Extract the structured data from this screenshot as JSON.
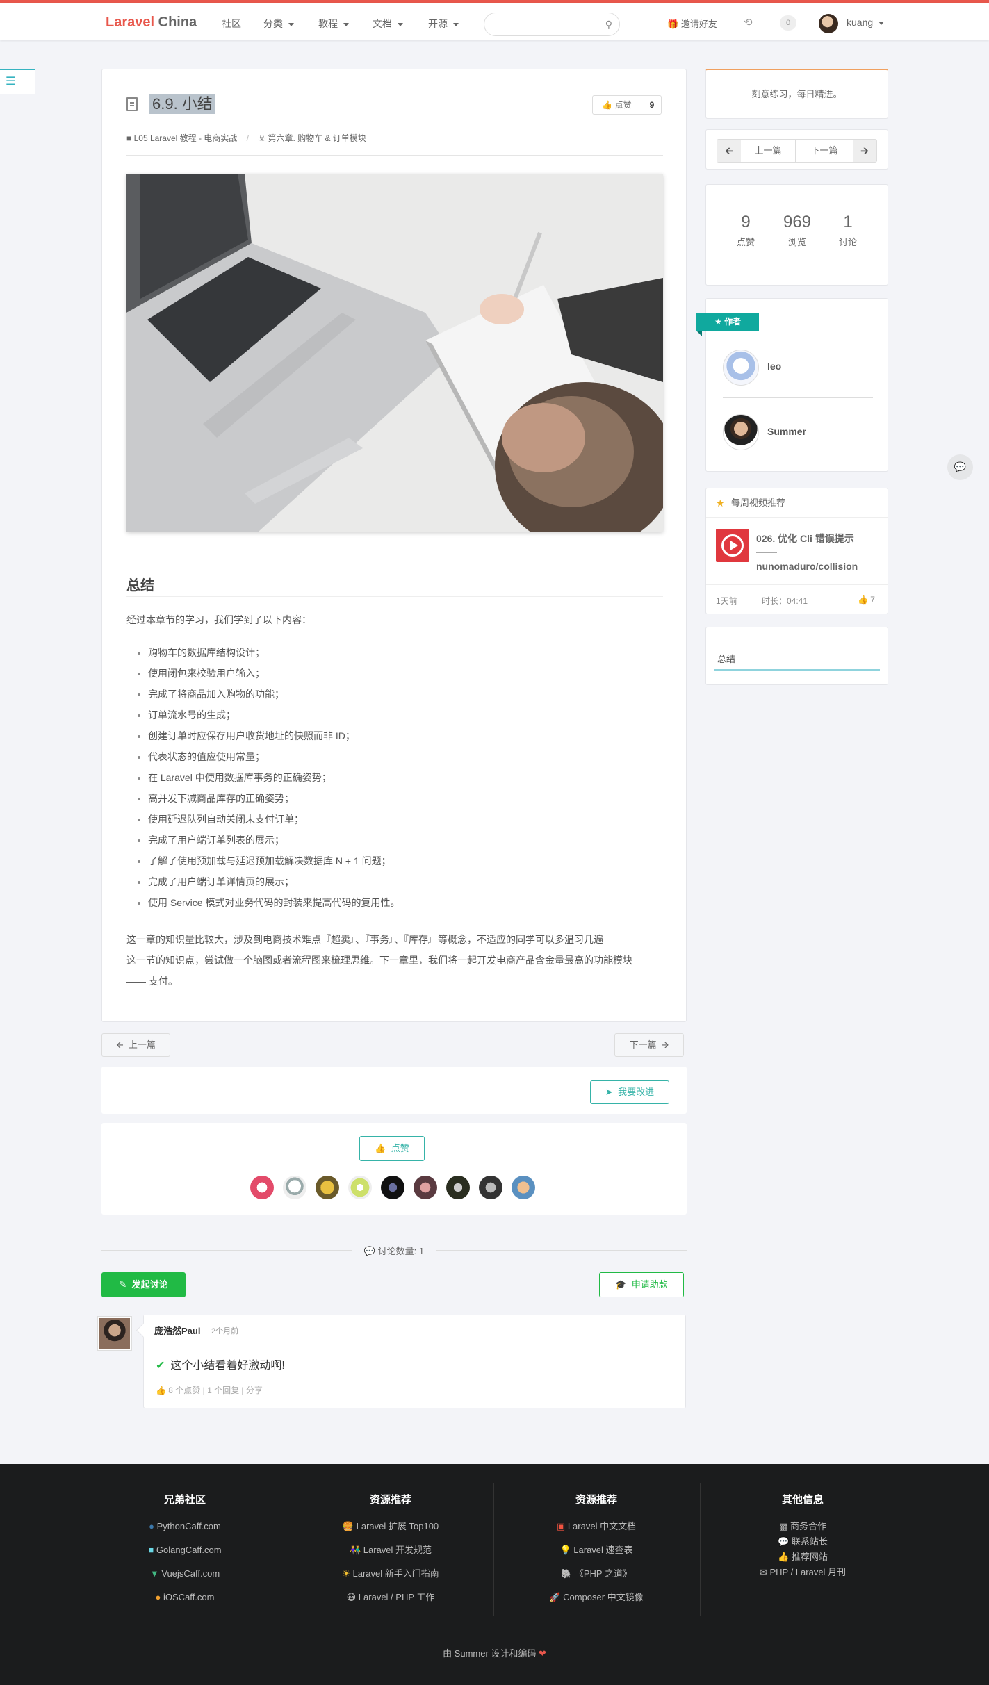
{
  "nav": {
    "logo_red": "Laravel",
    "logo_gray": " China",
    "links": [
      "社区",
      "分类",
      "教程",
      "文档",
      "开源"
    ],
    "invite": "邀请好友",
    "notif_count": "0",
    "username": "kuang"
  },
  "article": {
    "title": "6.9. 小结",
    "like_label": "点赞",
    "like_count": "9",
    "breadcrumb_book": "L05 Laravel 教程 - 电商实战",
    "breadcrumb_chapter": "第六章. 购物车 & 订单模块",
    "heading": "总结",
    "intro": "经过本章节的学习，我们学到了以下内容：",
    "items": [
      "购物车的数据库结构设计；",
      "使用闭包来校验用户输入；",
      "完成了将商品加入购物的功能；",
      "订单流水号的生成；",
      "创建订单时应保存用户收货地址的快照而非 ID；",
      "代表状态的值应使用常量；",
      "在 Laravel 中使用数据库事务的正确姿势；",
      "高并发下减商品库存的正确姿势；",
      "使用延迟队列自动关闭未支付订单；",
      "完成了用户端订单列表的展示；",
      "了解了使用预加载与延迟预加载解决数据库 N + 1 问题；",
      "完成了用户端订单详情页的展示；",
      "使用 Service 模式对业务代码的封装来提高代码的复用性。"
    ],
    "outro_line1": "这一章的知识量比较大，涉及到电商技术难点『超卖』、『事务』、『库存』等概念，不适应的同学可以多温习几遍",
    "outro_line2": "这一节的知识点，尝试做一个脑图或者流程图来梳理思维。下一章里，我们将一起开发电商产品含金量最高的功能模块",
    "outro_line3": "—— 支付。"
  },
  "pager": {
    "prev": "上一篇",
    "next": "下一篇"
  },
  "improve": "我要改进",
  "like_button": "点赞",
  "discussion": {
    "count_label": "讨论数量: 1",
    "start": "发起讨论",
    "fund": "申请助款"
  },
  "comment": {
    "author": "庞浩然Paul",
    "time": "2个月前",
    "text": "这个小结看着好激动啊!",
    "meta": "8 个点赞 |  1 个回复 |  分享"
  },
  "sidebar": {
    "motto": "刻意练习，每日精进。",
    "prev": "上一篇",
    "next": "下一篇",
    "stats": [
      {
        "num": "9",
        "label": "点赞"
      },
      {
        "num": "969",
        "label": "浏览"
      },
      {
        "num": "1",
        "label": "讨论"
      }
    ],
    "author_ribbon": "作者",
    "authors": [
      "leo",
      "Summer"
    ],
    "video_header": "每周视频推荐",
    "video_title": "026. 优化 Cli 错误提示",
    "video_sub": "nunomaduro/collision",
    "video_age": "1天前",
    "video_duration": "时长：04:41",
    "video_likes": "7",
    "toc": "总结"
  },
  "footer": {
    "cols": [
      {
        "title": "兄弟社区",
        "items": [
          "PythonCaff.com",
          "GolangCaff.com",
          "VuejsCaff.com",
          "iOSCaff.com"
        ]
      },
      {
        "title": "资源推荐",
        "items": [
          "Laravel 扩展 Top100",
          "Laravel 开发规范",
          "Laravel 新手入门指南",
          "Laravel / PHP 工作"
        ]
      },
      {
        "title": "资源推荐",
        "items": [
          "Laravel 中文文档",
          "Laravel 速查表",
          "《PHP 之道》",
          "Composer 中文镜像"
        ]
      },
      {
        "title": "其他信息",
        "items": [
          "商务合作",
          "联系站长",
          "推荐网站",
          "PHP / Laravel 月刊"
        ]
      }
    ],
    "copyright": "由 Summer 设计和编码"
  }
}
